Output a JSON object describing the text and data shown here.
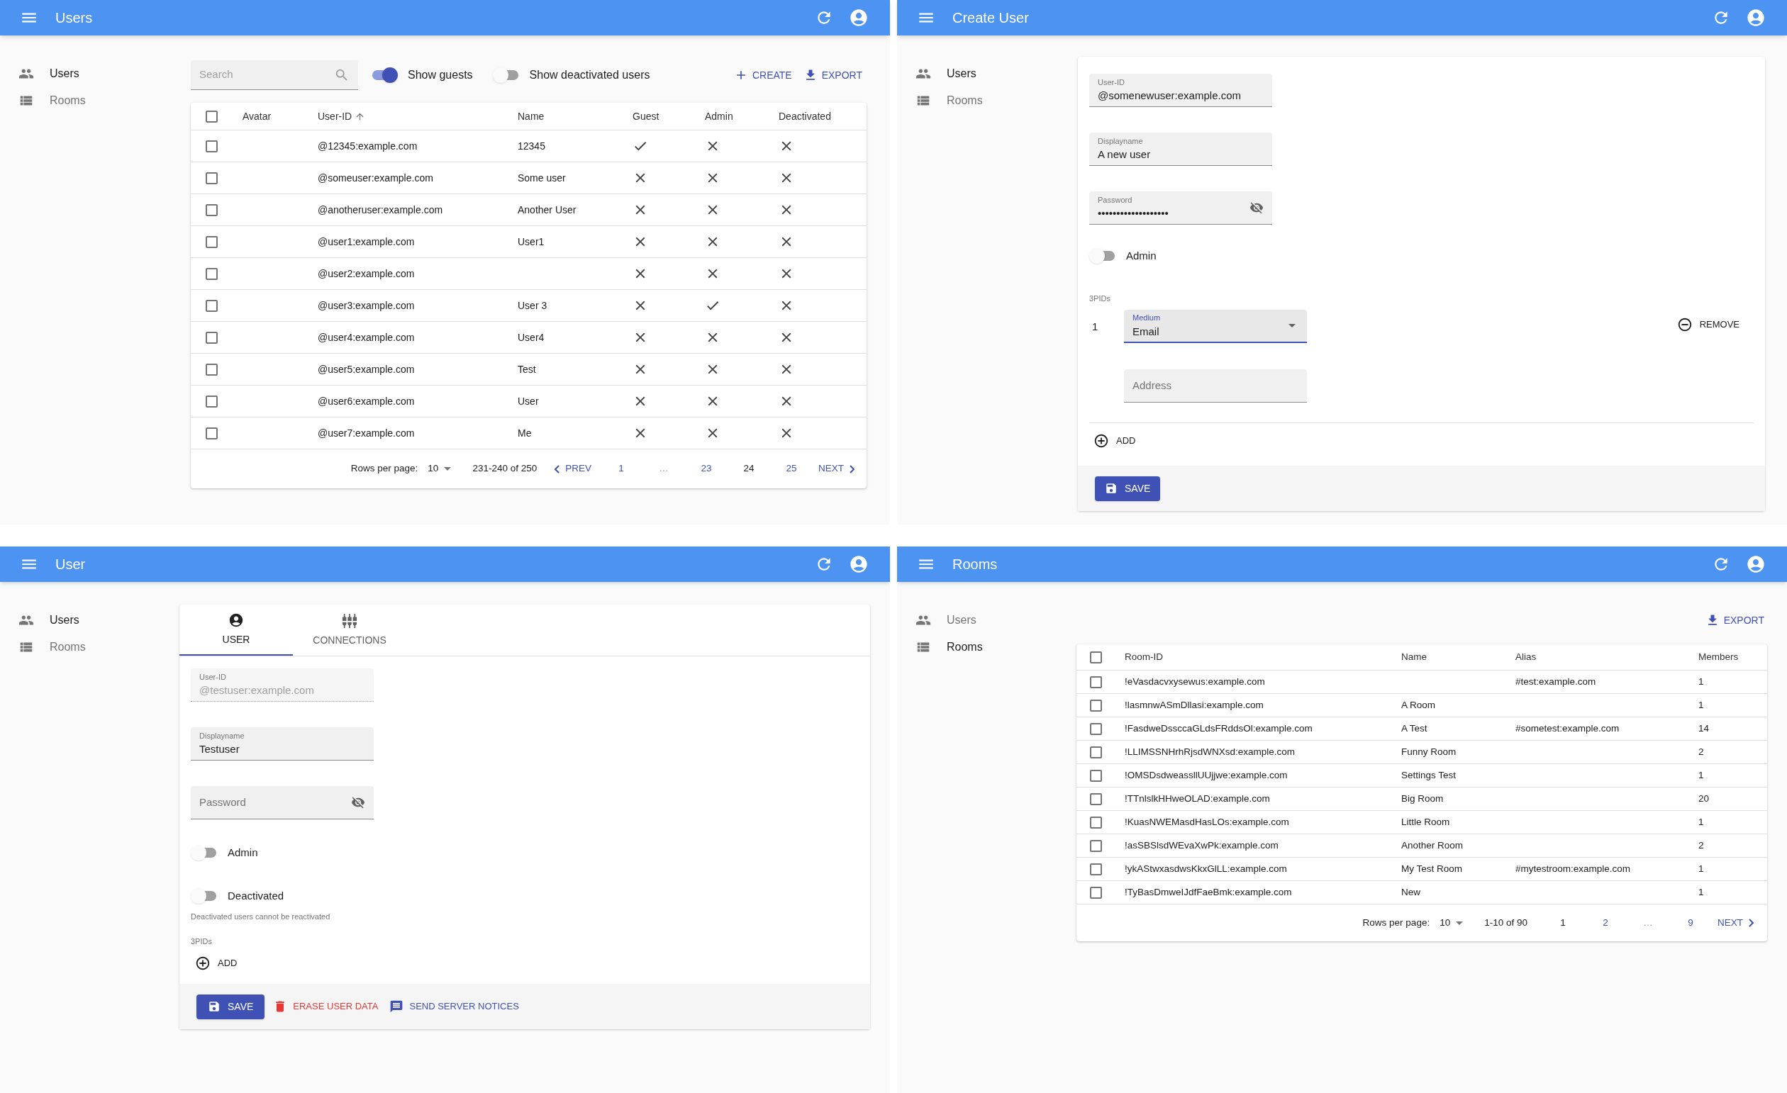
{
  "users_list": {
    "title": "Users",
    "sidebar": [
      {
        "label": "Users",
        "kind": "users",
        "selected": true
      },
      {
        "label": "Rooms",
        "kind": "rooms",
        "selected": false
      }
    ],
    "search": {
      "placeholder": "Search"
    },
    "toggles": [
      {
        "label": "Show guests",
        "on": true
      },
      {
        "label": "Show deactivated users",
        "on": false
      }
    ],
    "actions": [
      {
        "label": "CREATE",
        "kind": "create"
      },
      {
        "label": "EXPORT",
        "kind": "export"
      }
    ],
    "table": {
      "columns": [
        {
          "label": "Avatar",
          "sorted": false
        },
        {
          "label": "User-ID",
          "sorted": true
        },
        {
          "label": "Name",
          "sorted": false
        },
        {
          "label": "Guest",
          "sorted": false
        },
        {
          "label": "Admin",
          "sorted": false
        },
        {
          "label": "Deactivated",
          "sorted": false
        }
      ],
      "header_checked": false,
      "rows": [
        {
          "user_id": "@12345:example.com",
          "name": "12345",
          "guest": true,
          "admin": false,
          "deactivated": false,
          "checked": false
        },
        {
          "user_id": "@someuser:example.com",
          "name": "Some user",
          "guest": false,
          "admin": false,
          "deactivated": false,
          "checked": false
        },
        {
          "user_id": "@anotheruser:example.com",
          "name": "Another User",
          "guest": false,
          "admin": false,
          "deactivated": false,
          "checked": false
        },
        {
          "user_id": "@user1:example.com",
          "name": "User1",
          "guest": false,
          "admin": false,
          "deactivated": false,
          "checked": false
        },
        {
          "user_id": "@user2:example.com",
          "guest": false,
          "admin": false,
          "deactivated": false,
          "checked": false
        },
        {
          "user_id": "@user3:example.com",
          "name": "User 3",
          "guest": false,
          "admin": true,
          "deactivated": false,
          "checked": false
        },
        {
          "user_id": "@user4:example.com",
          "name": "User4",
          "guest": false,
          "admin": false,
          "deactivated": false,
          "checked": false
        },
        {
          "user_id": "@user5:example.com",
          "name": "Test",
          "guest": false,
          "admin": false,
          "deactivated": false,
          "checked": false
        },
        {
          "user_id": "@user6:example.com",
          "name": "User",
          "guest": false,
          "admin": false,
          "deactivated": false,
          "checked": false
        },
        {
          "user_id": "@user7:example.com",
          "name": "Me",
          "guest": false,
          "admin": false,
          "deactivated": false,
          "checked": false
        }
      ]
    },
    "pagination": {
      "rows_per_page_label": "Rows per page:",
      "rows_per_page": "10",
      "range": "231-240 of 250",
      "pages": [
        {
          "label": "PREV",
          "kind": "prev"
        },
        {
          "label": "1",
          "kind": "page",
          "selected": false
        },
        {
          "label": "…",
          "kind": "ellipsis"
        },
        {
          "label": "23",
          "kind": "page",
          "selected": false
        },
        {
          "label": "24",
          "kind": "page",
          "selected": true
        },
        {
          "label": "25",
          "kind": "page",
          "selected": false
        },
        {
          "label": "NEXT",
          "kind": "next"
        }
      ]
    }
  },
  "create_user": {
    "title": "Create User",
    "sidebar": [
      {
        "label": "Users",
        "kind": "users",
        "selected": true
      },
      {
        "label": "Rooms",
        "kind": "rooms",
        "selected": false
      }
    ],
    "fields": [
      {
        "label": "User-ID",
        "value": "@somenewuser:example.com",
        "kind": "text"
      },
      {
        "label": "Displayname",
        "value": "A new user",
        "kind": "text"
      },
      {
        "label": "Password",
        "value": "•••••••••••••••••••",
        "kind": "password"
      }
    ],
    "toggles": [
      {
        "label": "Admin",
        "on": false
      }
    ],
    "threepids_label": "3PIDs",
    "threepids": [
      {
        "index": "1",
        "medium": {
          "label": "Medium",
          "value": "Email",
          "focused": true
        },
        "address": {
          "placeholder": "Address"
        },
        "remove": "REMOVE"
      }
    ],
    "add": "ADD",
    "save": "SAVE"
  },
  "edit_user": {
    "title": "User",
    "sidebar": [
      {
        "label": "Users",
        "kind": "users",
        "selected": true
      },
      {
        "label": "Rooms",
        "kind": "rooms",
        "selected": false
      }
    ],
    "tabs": [
      {
        "label": "USER",
        "kind": "user",
        "selected": true
      },
      {
        "label": "CONNECTIONS",
        "kind": "connections",
        "selected": false
      }
    ],
    "fields": [
      {
        "label": "User-ID",
        "value": "@testuser:example.com",
        "kind": "text",
        "disabled": true
      },
      {
        "label": "Displayname",
        "value": "Testuser",
        "kind": "text",
        "disabled": false
      },
      {
        "placeholder": "Password",
        "kind": "password",
        "disabled": false
      }
    ],
    "toggles": [
      {
        "label": "Admin",
        "on": false
      },
      {
        "label": "Deactivated",
        "on": false,
        "helper": "Deactivated users cannot be reactivated"
      }
    ],
    "threepids_label": "3PIDs",
    "add": "ADD",
    "toolbar": [
      {
        "label": "SAVE",
        "kind": "save"
      },
      {
        "label": "ERASE USER DATA",
        "kind": "erase"
      },
      {
        "label": "SEND SERVER NOTICES",
        "kind": "notices"
      }
    ]
  },
  "rooms_list": {
    "title": "Rooms",
    "sidebar": [
      {
        "label": "Users",
        "kind": "users",
        "selected": false
      },
      {
        "label": "Rooms",
        "kind": "rooms",
        "selected": true
      }
    ],
    "actions": [
      {
        "label": "EXPORT",
        "kind": "export"
      }
    ],
    "table": {
      "columns": [
        "Room-ID",
        "Name",
        "Alias",
        "Members"
      ],
      "header_checked": false,
      "rows": [
        {
          "room_id": "!eVasdacvxysewus:example.com",
          "alias": "#test:example.com",
          "members": "1",
          "checked": false
        },
        {
          "room_id": "!lasmnwASmDllasi:example.com",
          "name": "A Room",
          "members": "1",
          "checked": false
        },
        {
          "room_id": "!FasdweDssccaGLdsFRddsOl:example.com",
          "name": "A Test",
          "alias": "#sometest:example.com",
          "members": "14",
          "checked": false
        },
        {
          "room_id": "!LLIMSSNHrhRjsdWNXsd:example.com",
          "name": "Funny Room",
          "members": "2",
          "checked": false
        },
        {
          "room_id": "!OMSDsdweassllUUjjwe:example.com",
          "name": "Settings Test",
          "members": "1",
          "checked": false
        },
        {
          "room_id": "!TTnlslkHHweOLAD:example.com",
          "name": "Big Room",
          "members": "20",
          "checked": false
        },
        {
          "room_id": "!KuasNWEMasdHasLOs:example.com",
          "name": "Little Room",
          "members": "1",
          "checked": false
        },
        {
          "room_id": "!asSBSlsdWEvaXwPk:example.com",
          "name": "Another Room",
          "members": "2",
          "checked": false
        },
        {
          "room_id": "!ykAStwxasdwsKkxGlLL:example.com",
          "name": "My Test Room",
          "alias": "#mytestroom:example.com",
          "members": "1",
          "checked": false
        },
        {
          "room_id": "!TyBasDmweIJdfFaeBmk:example.com",
          "name": "New",
          "members": "1",
          "checked": false
        }
      ]
    },
    "pagination": {
      "rows_per_page_label": "Rows per page:",
      "rows_per_page": "10",
      "range": "1-10 of 90",
      "pages": [
        {
          "label": "1",
          "kind": "page",
          "selected": true
        },
        {
          "label": "2",
          "kind": "page",
          "selected": false
        },
        {
          "label": "…",
          "kind": "ellipsis"
        },
        {
          "label": "9",
          "kind": "page",
          "selected": false
        },
        {
          "label": "NEXT",
          "kind": "next"
        }
      ]
    }
  }
}
